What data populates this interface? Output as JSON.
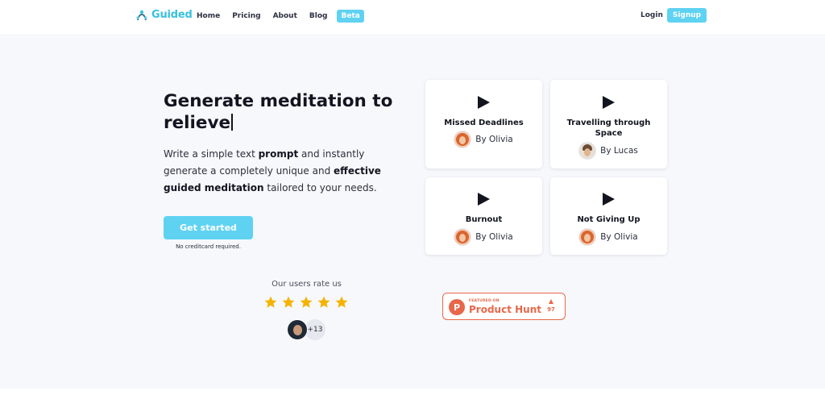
{
  "brand": {
    "name": "Guided",
    "accent": "#5fd2f2",
    "logo_color": "#39c0df"
  },
  "nav": {
    "items": [
      "Home",
      "Pricing",
      "About",
      "Blog"
    ],
    "beta_badge": "Beta",
    "login": "Login",
    "signup": "Signup"
  },
  "hero": {
    "headline": "Generate meditation to relieve",
    "description": {
      "p1": "Write a simple text ",
      "b1": "prompt",
      "p2": " and instantly generate a completely unique and ",
      "b2": "effective guided meditation",
      "p3": " tailored to your needs."
    },
    "cta": "Get started",
    "cta_note": "No creditcard required."
  },
  "cards": [
    {
      "title": "Missed Deadlines",
      "author": "By Olivia",
      "avatar": "olivia"
    },
    {
      "title": "Travelling through Space",
      "author": "By Lucas",
      "avatar": "lucas"
    },
    {
      "title": "Burnout",
      "author": "By Olivia",
      "avatar": "olivia"
    },
    {
      "title": "Not Giving Up",
      "author": "By Olivia",
      "avatar": "olivia"
    }
  ],
  "rating": {
    "label": "Our users rate us",
    "stars": 5,
    "star_color": "#f5b301",
    "extra_users": "+13"
  },
  "product_hunt": {
    "featured": "FEATURED ON",
    "name": "Product Hunt",
    "logo_letter": "P",
    "votes": "97",
    "color": "#e8674a"
  }
}
